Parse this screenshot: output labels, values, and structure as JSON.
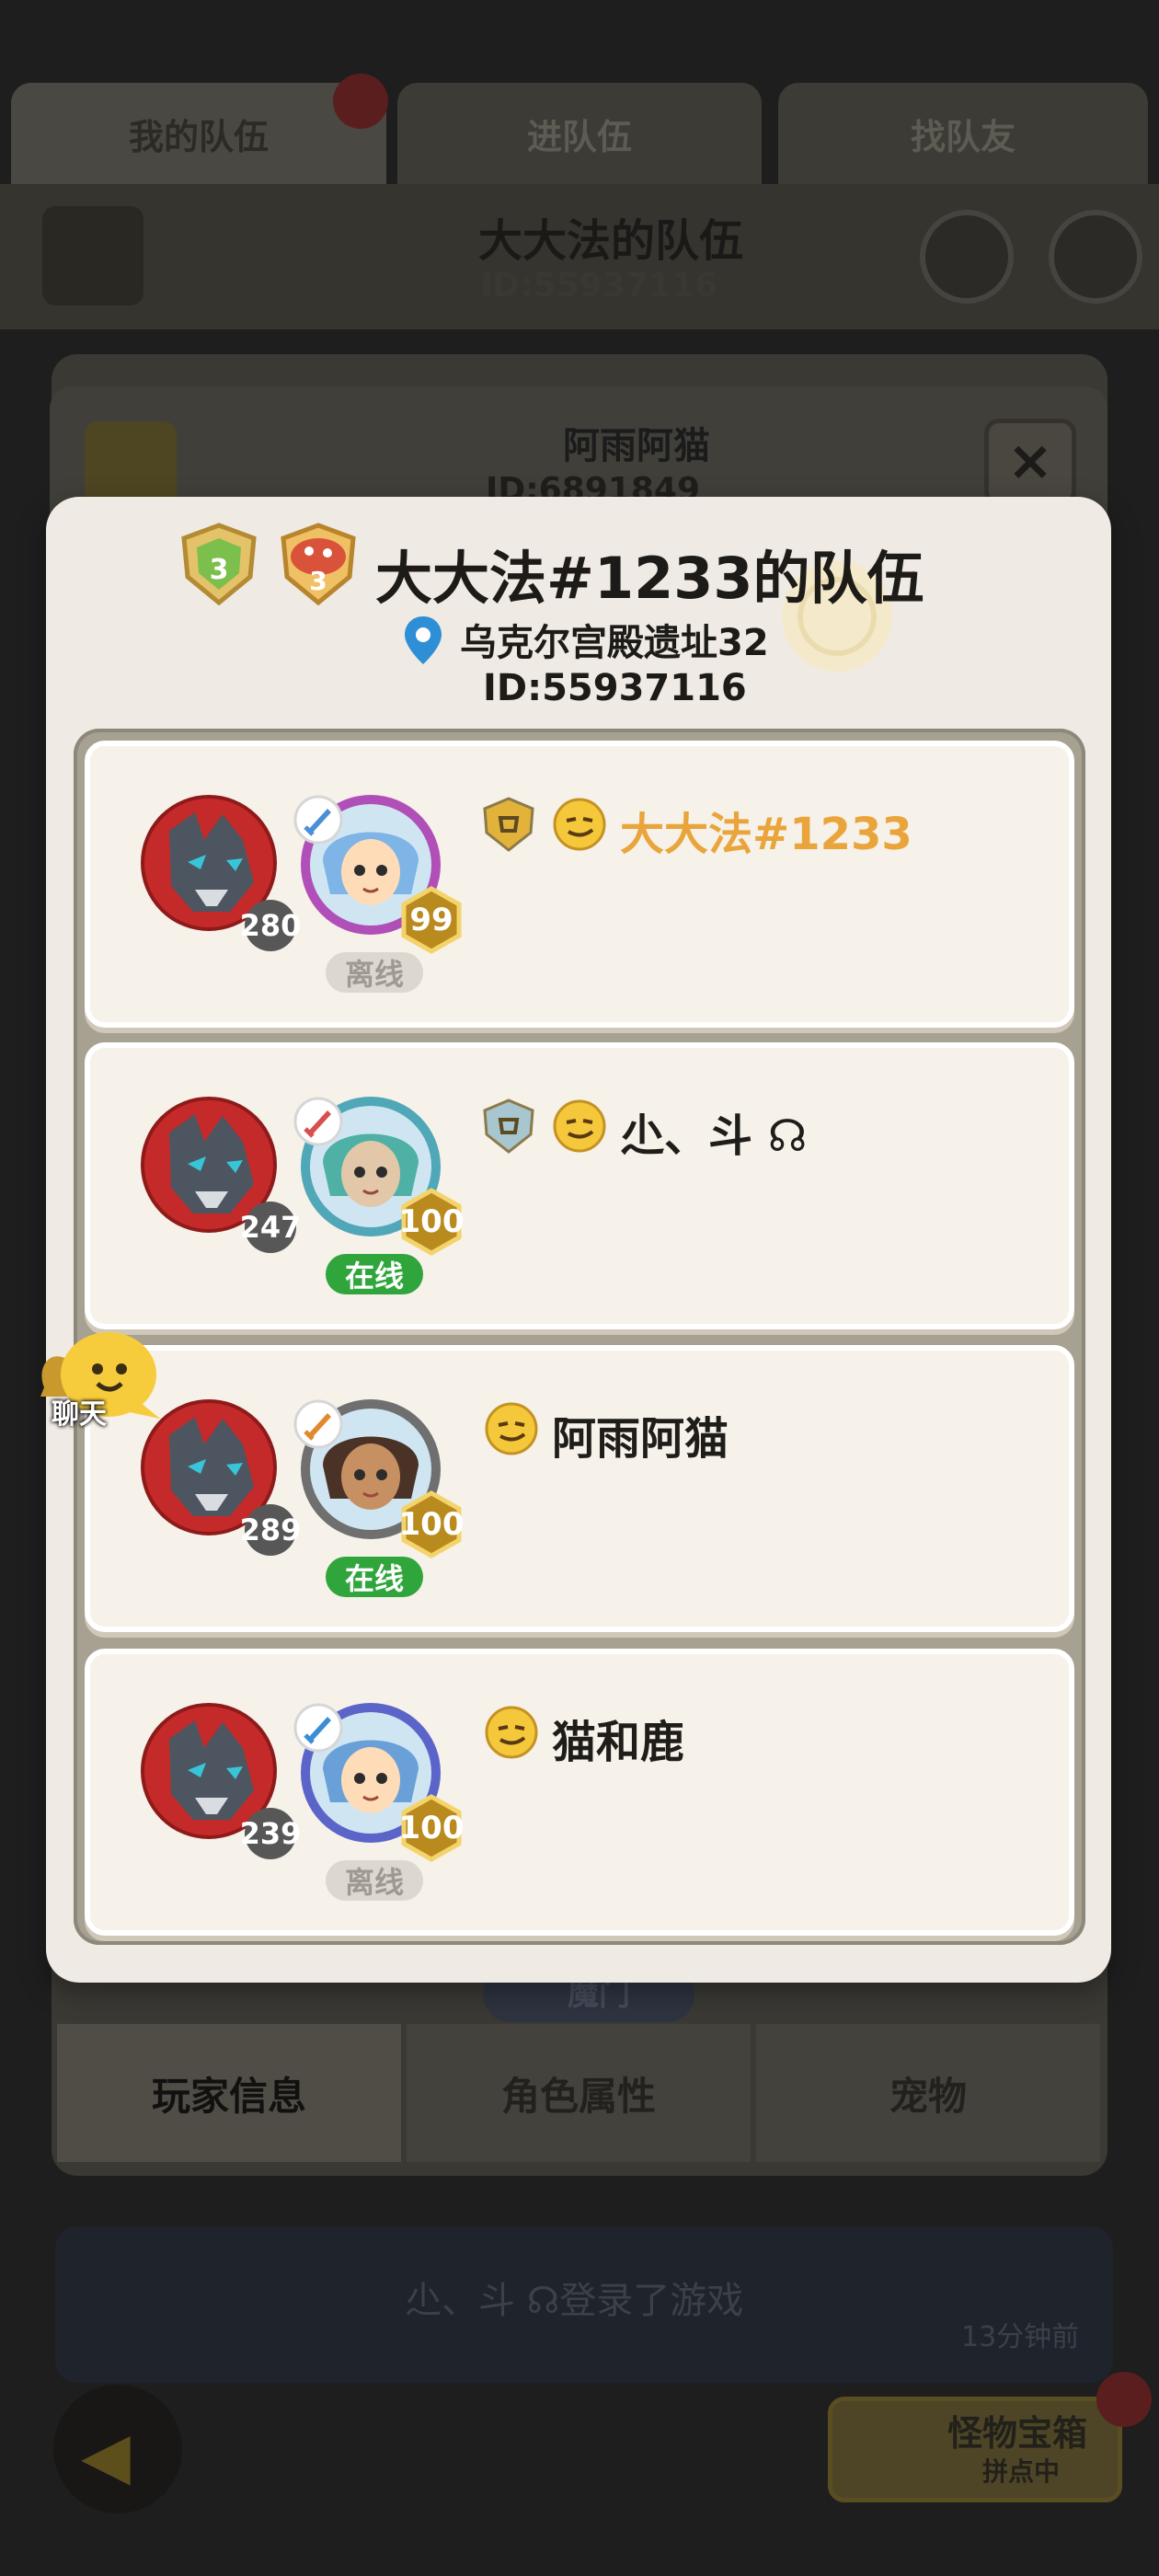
{
  "background": {
    "tabs": [
      {
        "label": "我的队伍",
        "active": true
      },
      {
        "label": "进队伍",
        "active": false
      },
      {
        "label": "找队友",
        "active": false
      }
    ],
    "team_title": "大大法的队伍",
    "team_id": "ID:55937116",
    "player_name": "阿雨阿猫",
    "player_id_partial": "ID:6891849",
    "close_label": "×",
    "bottom_tabs": [
      {
        "label": "玩家信息",
        "active": true
      },
      {
        "label": "角色属性",
        "active": false
      },
      {
        "label": "宠物",
        "active": false
      }
    ],
    "faction_label": "魔门",
    "notification": {
      "text": "尐、斗 ☊登录了游戏",
      "time": "13分钟前"
    },
    "treasure": {
      "title": "怪物宝箱",
      "subtitle": "拼点中"
    }
  },
  "popup": {
    "title": "大大法#1233的队伍",
    "location": "乌克尔宫殿遗址32",
    "id": "ID:55937116",
    "rank_badges": [
      {
        "icon": "green-rank-3-shield-icon",
        "value": "3"
      },
      {
        "icon": "mushroom-rank-3-icon",
        "value": "3"
      }
    ]
  },
  "members": [
    {
      "name": "大大法#1233",
      "pet_level": "280",
      "char_level": "99",
      "status": "离线",
      "online": false,
      "leader": true,
      "rank_icon": "gold-shield-icon",
      "class_icon": "sword-class-icon"
    },
    {
      "name": "尐、斗 ☊",
      "pet_level": "247",
      "char_level": "100",
      "status": "在线",
      "online": true,
      "leader": false,
      "rank_icon": "silver-shield-icon",
      "class_icon": "crossed-swords-class-icon"
    },
    {
      "name": "阿雨阿猫",
      "pet_level": "289",
      "char_level": "100",
      "status": "在线",
      "online": true,
      "leader": false,
      "rank_icon": "",
      "class_icon": "orange-sword-class-icon"
    },
    {
      "name": "猫和鹿",
      "pet_level": "239",
      "char_level": "100",
      "status": "离线",
      "online": false,
      "leader": false,
      "rank_icon": "",
      "class_icon": "water-swirl-class-icon"
    }
  ],
  "chat": {
    "label": "聊天"
  },
  "colors": {
    "popup_bg": "#efeae3",
    "leader_name": "#e9a53b",
    "online": "#2fa53b",
    "offline": "#dcd8d0"
  }
}
